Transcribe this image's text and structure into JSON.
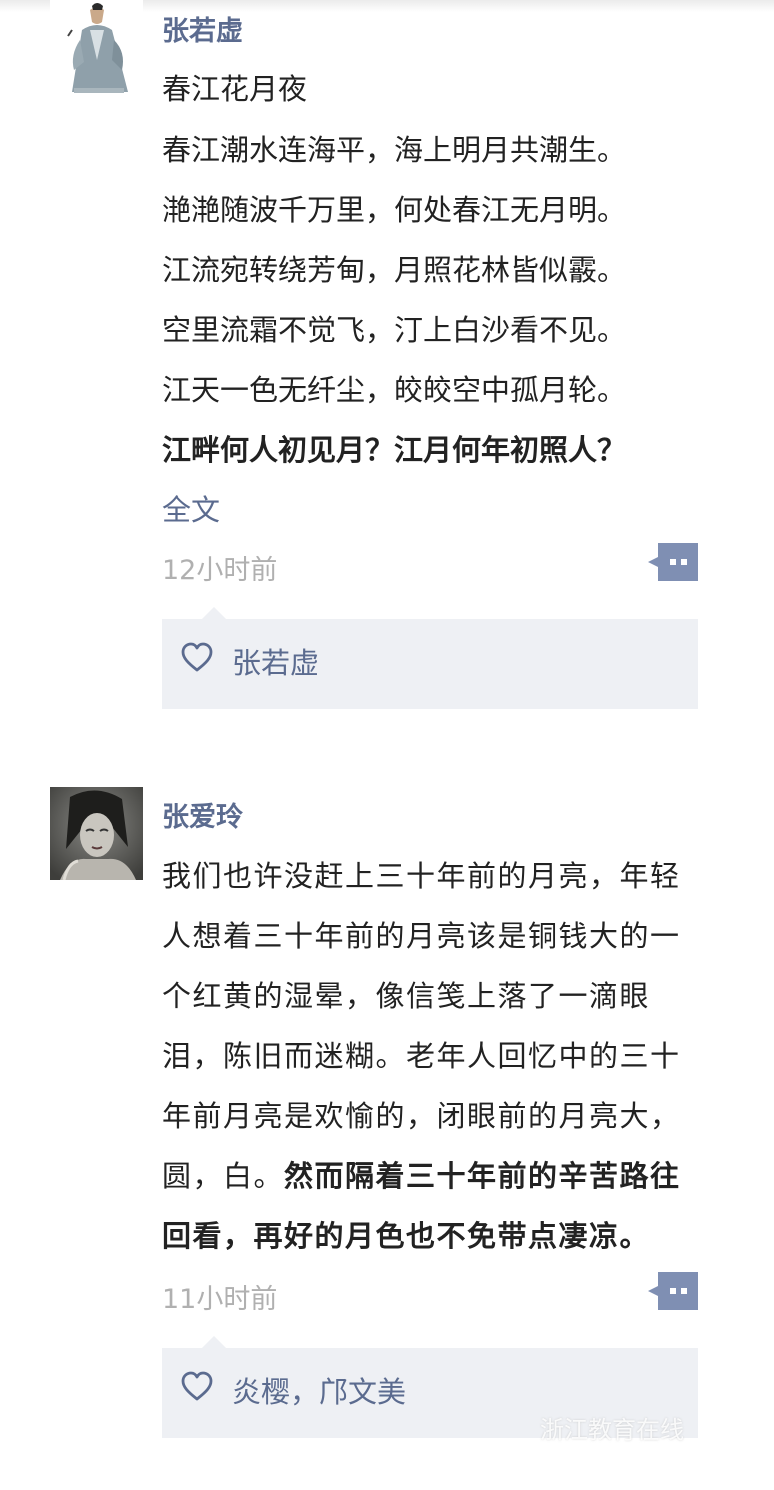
{
  "posts": [
    {
      "author": "张若虚",
      "lines": [
        "春江花月夜",
        "春江潮水连海平，海上明月共潮生。",
        "滟滟随波千万里，何处春江无月明。",
        "江流宛转绕芳甸，月照花林皆似霰。",
        "空里流霜不觉飞，汀上白沙看不见。",
        "江天一色无纤尘，皎皎空中孤月轮。"
      ],
      "bold_line": "江畔何人初见月？江月何年初照人？",
      "more_link": "全文",
      "time": "12小时前",
      "likes": "张若虚"
    },
    {
      "author": "张爱玲",
      "text_normal": "我们也许没赶上三十年前的月亮，年轻人想着三十年前的月亮该是铜钱大的一个红黄的湿晕，像信笺上落了一滴眼泪，陈旧而迷糊。老年人回忆中的三十年前月亮是欢愉的，闭眼前的月亮大，圆，白。",
      "text_bold": "然而隔着三十年前的辛苦路往回看，再好的月色也不免带点凄凉。",
      "time": "11小时前",
      "likes": "炎樱，邝文美"
    }
  ],
  "watermark": "浙江教育在线",
  "colors": {
    "link": "#5b6b8f",
    "time": "#b0b0b0",
    "likes_bg": "#eef0f4",
    "comment_btn": "#7f8fb3"
  },
  "icons": [
    "comment-icon",
    "heart-icon"
  ]
}
